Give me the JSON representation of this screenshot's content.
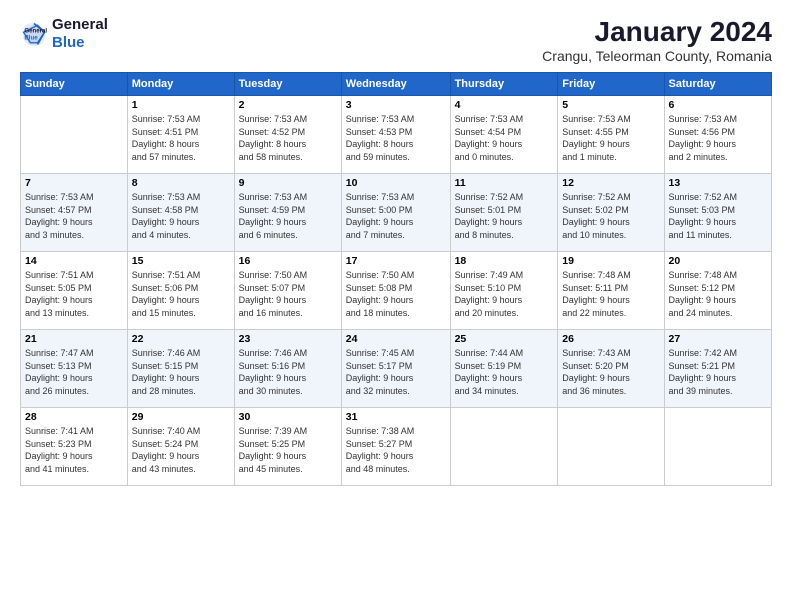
{
  "logo": {
    "line1": "General",
    "line2": "Blue"
  },
  "title": "January 2024",
  "subtitle": "Crangu, Teleorman County, Romania",
  "days_header": [
    "Sunday",
    "Monday",
    "Tuesday",
    "Wednesday",
    "Thursday",
    "Friday",
    "Saturday"
  ],
  "weeks": [
    [
      {
        "num": "",
        "info": ""
      },
      {
        "num": "1",
        "info": "Sunrise: 7:53 AM\nSunset: 4:51 PM\nDaylight: 8 hours\nand 57 minutes."
      },
      {
        "num": "2",
        "info": "Sunrise: 7:53 AM\nSunset: 4:52 PM\nDaylight: 8 hours\nand 58 minutes."
      },
      {
        "num": "3",
        "info": "Sunrise: 7:53 AM\nSunset: 4:53 PM\nDaylight: 8 hours\nand 59 minutes."
      },
      {
        "num": "4",
        "info": "Sunrise: 7:53 AM\nSunset: 4:54 PM\nDaylight: 9 hours\nand 0 minutes."
      },
      {
        "num": "5",
        "info": "Sunrise: 7:53 AM\nSunset: 4:55 PM\nDaylight: 9 hours\nand 1 minute."
      },
      {
        "num": "6",
        "info": "Sunrise: 7:53 AM\nSunset: 4:56 PM\nDaylight: 9 hours\nand 2 minutes."
      }
    ],
    [
      {
        "num": "7",
        "info": "Sunrise: 7:53 AM\nSunset: 4:57 PM\nDaylight: 9 hours\nand 3 minutes."
      },
      {
        "num": "8",
        "info": "Sunrise: 7:53 AM\nSunset: 4:58 PM\nDaylight: 9 hours\nand 4 minutes."
      },
      {
        "num": "9",
        "info": "Sunrise: 7:53 AM\nSunset: 4:59 PM\nDaylight: 9 hours\nand 6 minutes."
      },
      {
        "num": "10",
        "info": "Sunrise: 7:53 AM\nSunset: 5:00 PM\nDaylight: 9 hours\nand 7 minutes."
      },
      {
        "num": "11",
        "info": "Sunrise: 7:52 AM\nSunset: 5:01 PM\nDaylight: 9 hours\nand 8 minutes."
      },
      {
        "num": "12",
        "info": "Sunrise: 7:52 AM\nSunset: 5:02 PM\nDaylight: 9 hours\nand 10 minutes."
      },
      {
        "num": "13",
        "info": "Sunrise: 7:52 AM\nSunset: 5:03 PM\nDaylight: 9 hours\nand 11 minutes."
      }
    ],
    [
      {
        "num": "14",
        "info": "Sunrise: 7:51 AM\nSunset: 5:05 PM\nDaylight: 9 hours\nand 13 minutes."
      },
      {
        "num": "15",
        "info": "Sunrise: 7:51 AM\nSunset: 5:06 PM\nDaylight: 9 hours\nand 15 minutes."
      },
      {
        "num": "16",
        "info": "Sunrise: 7:50 AM\nSunset: 5:07 PM\nDaylight: 9 hours\nand 16 minutes."
      },
      {
        "num": "17",
        "info": "Sunrise: 7:50 AM\nSunset: 5:08 PM\nDaylight: 9 hours\nand 18 minutes."
      },
      {
        "num": "18",
        "info": "Sunrise: 7:49 AM\nSunset: 5:10 PM\nDaylight: 9 hours\nand 20 minutes."
      },
      {
        "num": "19",
        "info": "Sunrise: 7:48 AM\nSunset: 5:11 PM\nDaylight: 9 hours\nand 22 minutes."
      },
      {
        "num": "20",
        "info": "Sunrise: 7:48 AM\nSunset: 5:12 PM\nDaylight: 9 hours\nand 24 minutes."
      }
    ],
    [
      {
        "num": "21",
        "info": "Sunrise: 7:47 AM\nSunset: 5:13 PM\nDaylight: 9 hours\nand 26 minutes."
      },
      {
        "num": "22",
        "info": "Sunrise: 7:46 AM\nSunset: 5:15 PM\nDaylight: 9 hours\nand 28 minutes."
      },
      {
        "num": "23",
        "info": "Sunrise: 7:46 AM\nSunset: 5:16 PM\nDaylight: 9 hours\nand 30 minutes."
      },
      {
        "num": "24",
        "info": "Sunrise: 7:45 AM\nSunset: 5:17 PM\nDaylight: 9 hours\nand 32 minutes."
      },
      {
        "num": "25",
        "info": "Sunrise: 7:44 AM\nSunset: 5:19 PM\nDaylight: 9 hours\nand 34 minutes."
      },
      {
        "num": "26",
        "info": "Sunrise: 7:43 AM\nSunset: 5:20 PM\nDaylight: 9 hours\nand 36 minutes."
      },
      {
        "num": "27",
        "info": "Sunrise: 7:42 AM\nSunset: 5:21 PM\nDaylight: 9 hours\nand 39 minutes."
      }
    ],
    [
      {
        "num": "28",
        "info": "Sunrise: 7:41 AM\nSunset: 5:23 PM\nDaylight: 9 hours\nand 41 minutes."
      },
      {
        "num": "29",
        "info": "Sunrise: 7:40 AM\nSunset: 5:24 PM\nDaylight: 9 hours\nand 43 minutes."
      },
      {
        "num": "30",
        "info": "Sunrise: 7:39 AM\nSunset: 5:25 PM\nDaylight: 9 hours\nand 45 minutes."
      },
      {
        "num": "31",
        "info": "Sunrise: 7:38 AM\nSunset: 5:27 PM\nDaylight: 9 hours\nand 48 minutes."
      },
      {
        "num": "",
        "info": ""
      },
      {
        "num": "",
        "info": ""
      },
      {
        "num": "",
        "info": ""
      }
    ]
  ]
}
